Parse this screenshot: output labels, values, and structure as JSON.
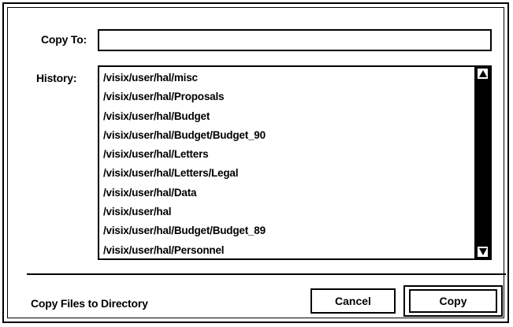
{
  "dialog": {
    "copy_to_label": "Copy To:",
    "copy_to_value": "",
    "history_label": "History:",
    "history_items": [
      "/visix/user/hal/misc",
      "/visix/user/hal/Proposals",
      "/visix/user/hal/Budget",
      "/visix/user/hal/Budget/Budget_90",
      "/visix/user/hal/Letters",
      "/visix/user/hal/Letters/Legal",
      "/visix/user/hal/Data",
      "/visix/user/hal",
      "/visix/user/hal/Budget/Budget_89",
      "/visix/user/hal/Personnel"
    ],
    "status_text": "Copy Files to Directory",
    "cancel_label": "Cancel",
    "copy_label": "Copy"
  },
  "icons": {
    "scroll_up": "triangle-up-icon",
    "scroll_down": "triangle-down-icon"
  }
}
